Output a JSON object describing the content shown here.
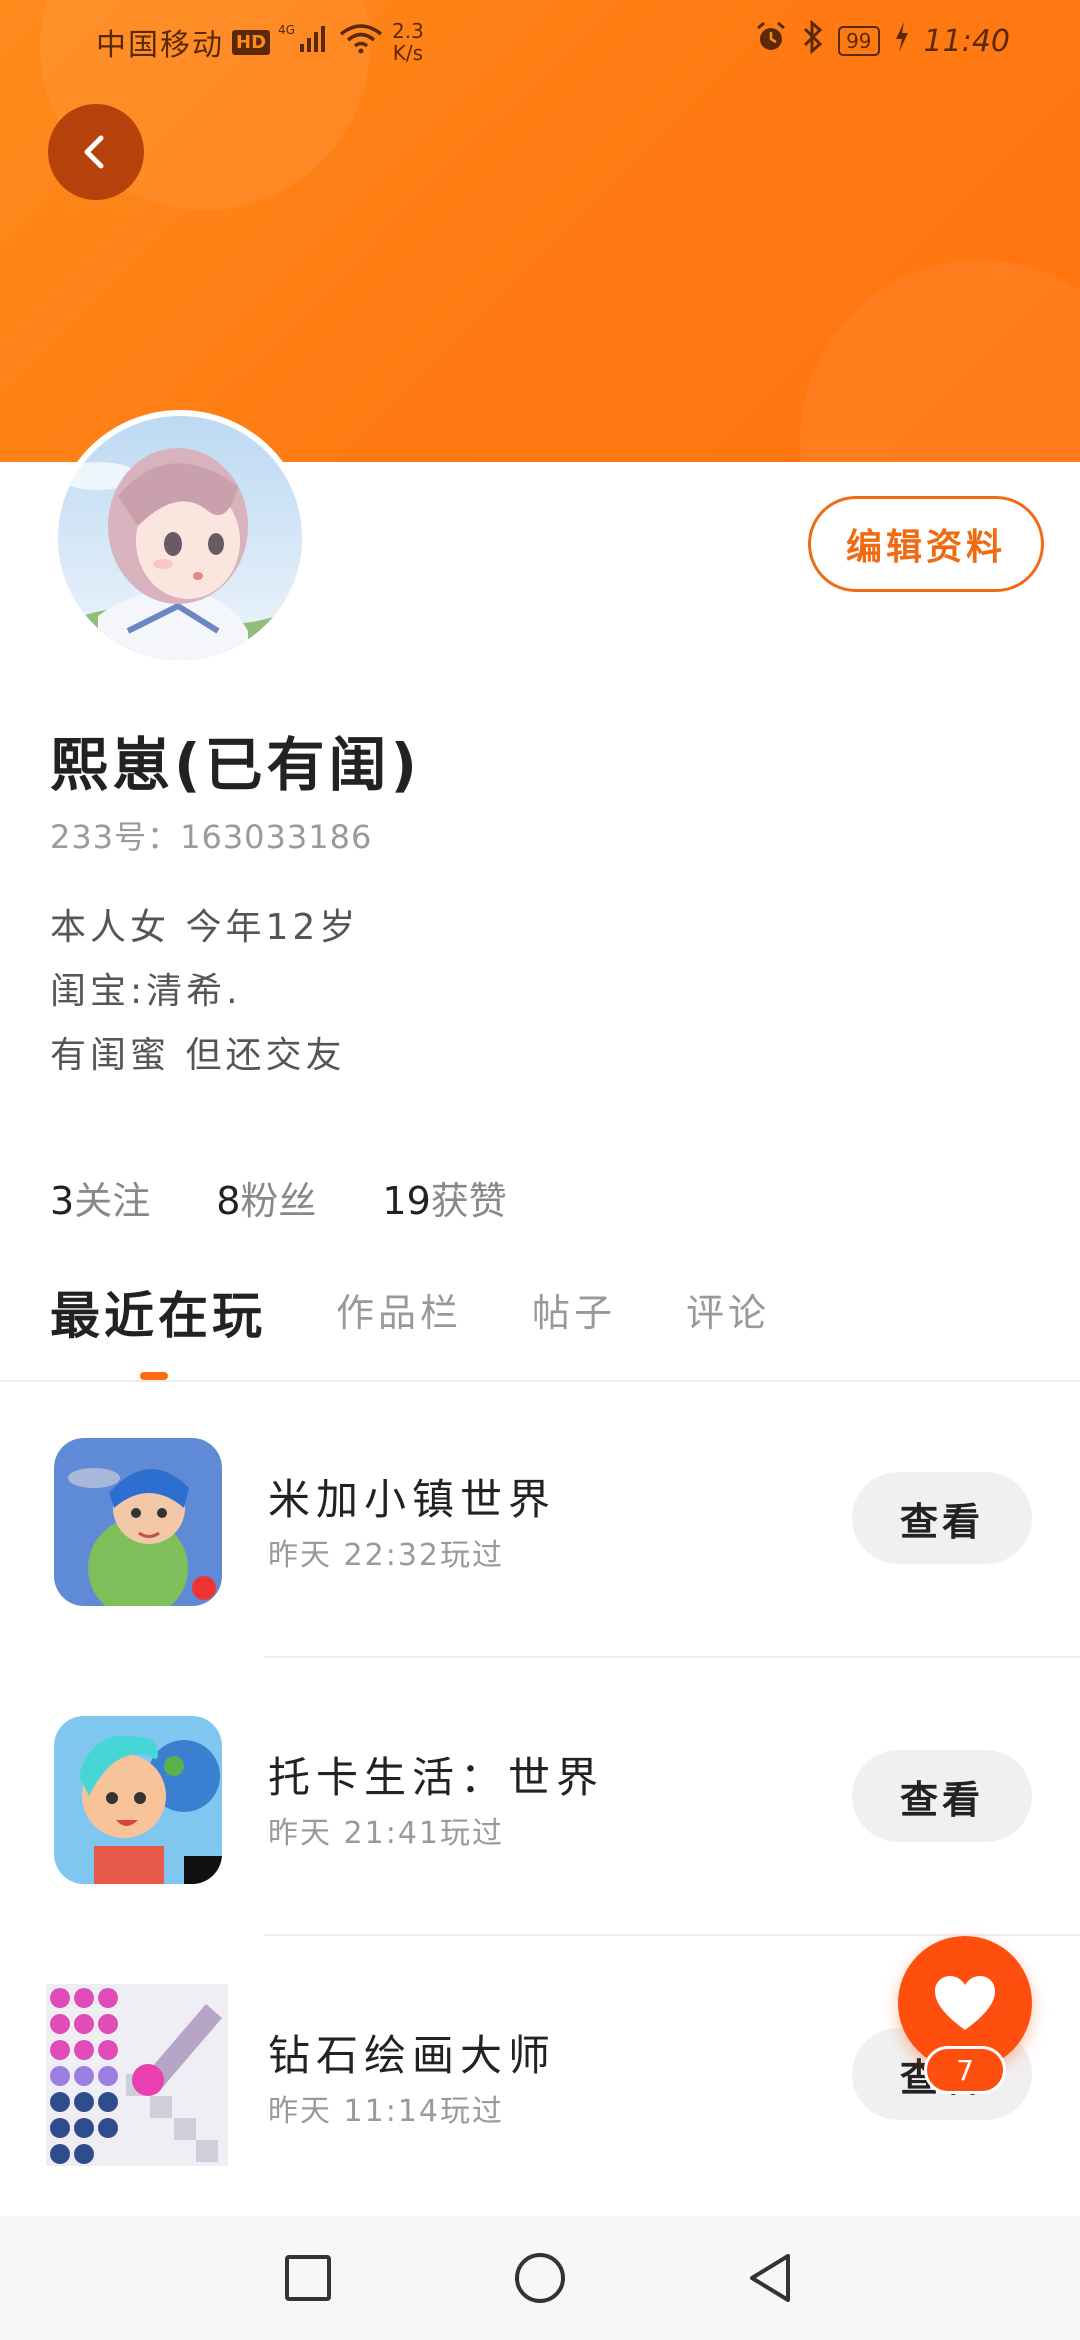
{
  "status_bar": {
    "carrier": "中国移动",
    "hd": "HD",
    "network": "4G",
    "speed_value": "2.3",
    "speed_unit": "K/s",
    "battery": "99",
    "time": "11:40"
  },
  "profile": {
    "username": "熙崽(已有闺)",
    "uid_label": "233号：",
    "uid_value": "163033186",
    "edit_button": "编辑资料",
    "bio": [
      "本人女  今年12岁",
      "闺宝:清希.",
      "有闺蜜  但还交友"
    ],
    "stats": [
      {
        "num": "3",
        "label": "关注"
      },
      {
        "num": "8",
        "label": "粉丝"
      },
      {
        "num": "19",
        "label": "获赞"
      }
    ]
  },
  "tabs": [
    {
      "label": "最近在玩",
      "active": true
    },
    {
      "label": "作品栏",
      "active": false
    },
    {
      "label": "帖子",
      "active": false
    },
    {
      "label": "评论",
      "active": false
    }
  ],
  "games": [
    {
      "name": "米加小镇世界",
      "time": "昨天 22:32玩过",
      "button": "查看"
    },
    {
      "name": "托卡生活：世界",
      "time": "昨天 21:41玩过",
      "button": "查看"
    },
    {
      "name": "钻石绘画大师",
      "time": "昨天 11:14玩过",
      "button": "查看"
    }
  ],
  "like_fab": {
    "count": "7"
  },
  "colors": {
    "accent": "#ff7a12",
    "like": "#ff4f0f"
  },
  "icons": {
    "back": "chevron-left-icon",
    "like": "heart-icon",
    "nav_recent": "square-icon",
    "nav_home": "circle-icon",
    "nav_back": "triangle-back-icon"
  }
}
